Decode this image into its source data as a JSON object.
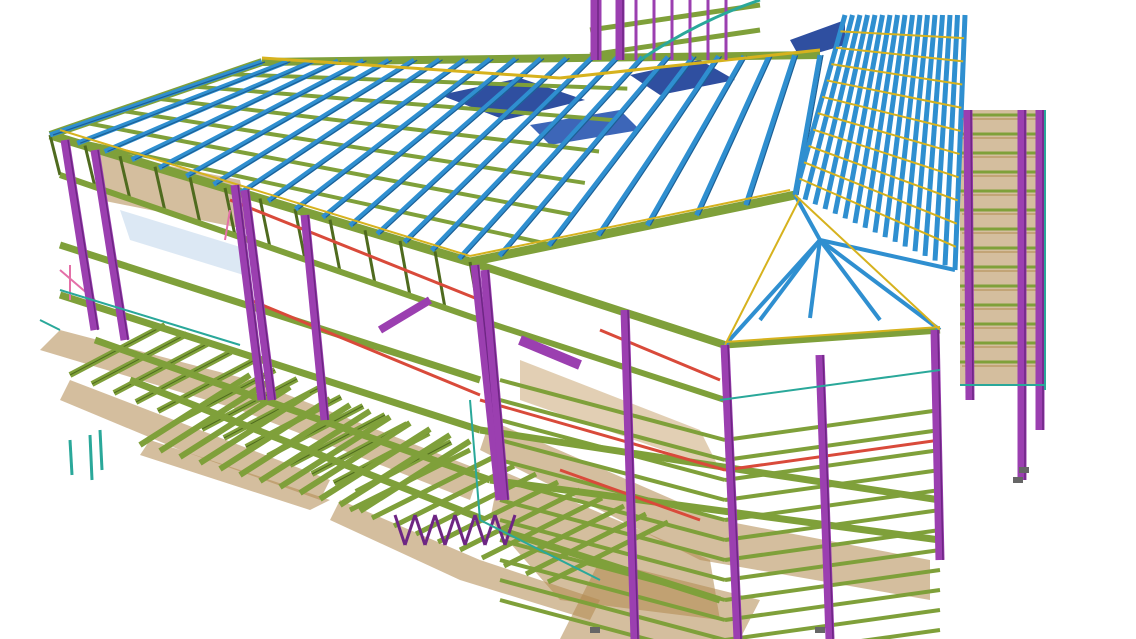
{
  "scene": {
    "subject": "steel-structure-3d-model",
    "background_color": "#ffffff",
    "colors": {
      "column": "#9b3fb0",
      "column_dark": "#6e2684",
      "beam": "#7fa03a",
      "beam_dark": "#4f6b1f",
      "rafter": "#2f8fd0",
      "rafter_dark": "#1c5f95",
      "purlin": "#d6b21e",
      "deck": "#b0894f",
      "roof_panel": "#2f4fa0",
      "brace": "#d94a3a",
      "rail": "#e46fa8",
      "trim": "#2aa89a"
    }
  }
}
